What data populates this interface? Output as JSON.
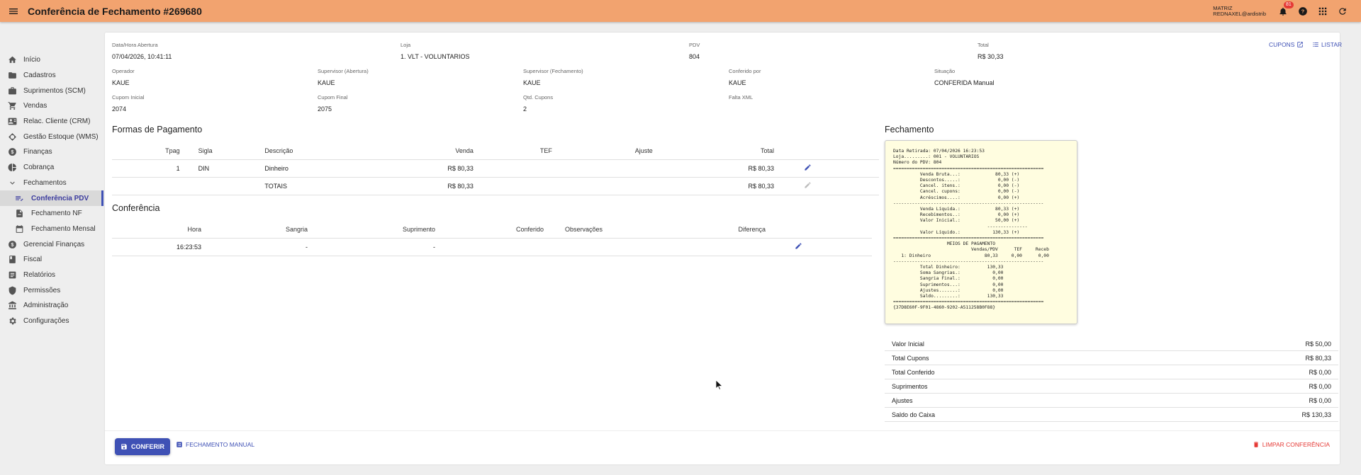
{
  "appbar": {
    "title": "Conferência de Fechamento #269680",
    "company": "MATRIZ",
    "user": "REDNAXEL@ardistrib",
    "notification_count": "81"
  },
  "sidebar": {
    "items": [
      {
        "label": "Início",
        "icon": "home-icon"
      },
      {
        "label": "Cadastros",
        "icon": "folder-icon"
      },
      {
        "label": "Suprimentos (SCM)",
        "icon": "box-icon"
      },
      {
        "label": "Vendas",
        "icon": "cart-icon"
      },
      {
        "label": "Relac. Cliente (CRM)",
        "icon": "contact-card-icon"
      },
      {
        "label": "Gestão Estoque (WMS)",
        "icon": "warehouse-icon"
      },
      {
        "label": "Finanças",
        "icon": "dollar-icon"
      },
      {
        "label": "Cobrança",
        "icon": "pie-icon"
      },
      {
        "label": "Fechamentos",
        "icon": "chevron-down-icon"
      },
      {
        "label": "Conferência PDV",
        "icon": "list-check-icon"
      },
      {
        "label": "Fechamento NF",
        "icon": "document-icon"
      },
      {
        "label": "Fechamento Mensal",
        "icon": "calendar-icon"
      },
      {
        "label": "Gerencial Finanças",
        "icon": "dollar-icon"
      },
      {
        "label": "Fiscal",
        "icon": "book-icon"
      },
      {
        "label": "Relatórios",
        "icon": "report-icon"
      },
      {
        "label": "Permissões",
        "icon": "shield-icon"
      },
      {
        "label": "Administração",
        "icon": "bank-icon"
      },
      {
        "label": "Configurações",
        "icon": "gear-icon"
      }
    ]
  },
  "header": {
    "abertura_label": "Data/Hora Abertura",
    "abertura": "07/04/2026, 10:41:11",
    "loja_label": "Loja",
    "loja": "1. VLT - VOLUNTARIOS",
    "pdv_label": "PDV",
    "pdv": "804",
    "total_label": "Total",
    "total": "R$ 30,33",
    "cupons_link": "CUPONS",
    "listar_link": "LISTAR",
    "operador_label": "Operador",
    "operador": "KAUE",
    "sup_abertura_label": "Supervisor (Abertura)",
    "sup_abertura": "KAUE",
    "sup_fechamento_label": "Supervisor (Fechamento)",
    "sup_fechamento": "KAUE",
    "conferido_label": "Conferido por",
    "conferido": "KAUE",
    "situacao_label": "Situação",
    "situacao": "CONFERIDA Manual",
    "cupom_ini_label": "Cupom Inicial",
    "cupom_ini": "2074",
    "cupom_fin_label": "Cupom Final",
    "cupom_fin": "2075",
    "qtd_label": "Qtd. Cupons",
    "qtd": "2",
    "falta_label": "Falta XML"
  },
  "pagamento": {
    "title": "Formas de Pagamento",
    "columns": [
      "Tpag",
      "Sigla",
      "Descrição",
      "Venda",
      "TEF",
      "Ajuste",
      "Total"
    ],
    "rows": [
      {
        "tpag": "1",
        "sigla": "DIN",
        "descricao": "Dinheiro",
        "venda": "R$ 80,33",
        "tef": "",
        "ajuste": "",
        "total": "R$ 80,33"
      },
      {
        "tpag": "",
        "sigla": "",
        "descricao": "TOTAIS",
        "venda": "R$ 80,33",
        "tef": "",
        "ajuste": "",
        "total": "R$ 80,33"
      }
    ]
  },
  "conferencia": {
    "title": "Conferência",
    "columns": [
      "Hora",
      "Sangria",
      "Suprimento",
      "Conferido",
      "Observações",
      "Diferença"
    ],
    "rows": [
      {
        "hora": "16:23:53",
        "sangria": "-",
        "suprimento": "-",
        "conferido": "",
        "obs": "",
        "diferenca": ""
      }
    ]
  },
  "fechamento": {
    "title": "Fechamento",
    "receipt": "Data Retirada: 07/04/2026 16:23:53\nLoja.........: 001 - VOLUNTARIOS\nNúmero do PDV: 804\n========================================================\n          Venda Bruta...:             80,33 (+)\n          Descontos.....:              0,00 (-)\n          Cancel. itens.:              0,00 (-)\n          Cancel. cupons:              0,00 (-)\n          Acréscimos....:              0,00 (+)\n--------------------------------------------------------\n          Venda Líquida.:             80,33 (+)\n          Recebimentos..:              0,00 (+)\n          Valor Inicial.:             50,00 (+)\n                                   ---------------\n          Valor Líquido.:            130,33 (+)\n========================================================\n                    MEIOS DE PAGAMENTO\n                             Vendas/PDV      TEF     Receb\n   1: Dinheiro                    80,33     0,00      0,00\n--------------------------------------------------------\n          Total Dinheiro:          130,33\n          Soma Sangrias.:            0,00\n          Sangria Final.:            0,00\n          Suprimentos...:            0,00\n          Ajustes.......:            0,00\n          Saldo.........:          130,33\n========================================================\n{37D8E60F-9F01-4860-9202-A511258B0F88}",
    "totals": [
      {
        "label": "Valor Inicial",
        "value": "R$ 50,00"
      },
      {
        "label": "Total Cupons",
        "value": "R$ 80,33"
      },
      {
        "label": "Total Conferido",
        "value": "R$ 0,00"
      },
      {
        "label": "Suprimentos",
        "value": "R$ 0,00"
      },
      {
        "label": "Ajustes",
        "value": "R$ 0,00"
      },
      {
        "label": "Saldo do Caixa",
        "value": "R$ 130,33"
      }
    ]
  },
  "footer": {
    "conferir": "CONFERIR",
    "fechamento_manual": "FECHAMENTO MANUAL",
    "limpar": "LIMPAR CONFERÊNCIA"
  },
  "colors": {
    "appbar": "#f2a36f",
    "primary": "#3f51b5",
    "danger": "#e53935",
    "receipt": "#fffde0"
  }
}
